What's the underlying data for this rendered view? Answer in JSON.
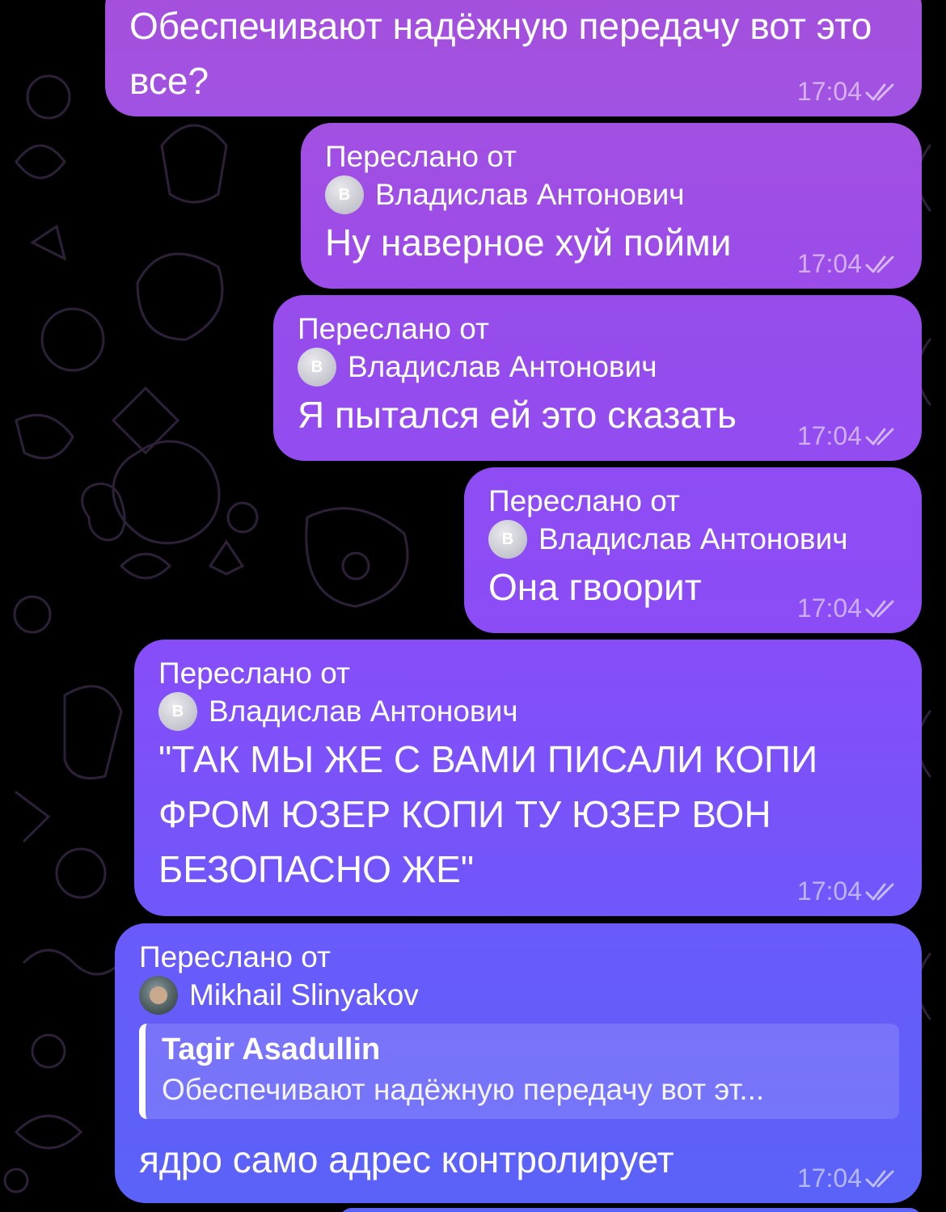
{
  "messages": [
    {
      "text": "Обеспечивают надёжную передачу вот это все?",
      "time": "17:04"
    },
    {
      "forward_label": "Переслано от",
      "forward_avatar_letter": "В",
      "forward_from": "Владислав Антонович",
      "text": "Ну наверное хуй пойми",
      "time": "17:04"
    },
    {
      "forward_label": "Переслано от",
      "forward_avatar_letter": "В",
      "forward_from": "Владислав Антонович",
      "text": "Я пытался ей это сказать",
      "time": "17:04"
    },
    {
      "forward_label": "Переслано от",
      "forward_avatar_letter": "В",
      "forward_from": "Владислав Антонович",
      "text": "Она гвоорит",
      "time": "17:04"
    },
    {
      "forward_label": "Переслано от",
      "forward_avatar_letter": "В",
      "forward_from": "Владислав Антонович",
      "text": "\"ТАК МЫ ЖЕ С ВАМИ ПИСАЛИ КОПИ ФРОМ ЮЗЕР КОПИ ТУ ЮЗЕР ВОН БЕЗОПАСНО ЖЕ\"",
      "time": "17:04"
    },
    {
      "forward_label": "Переслано от",
      "forward_from": "Mikhail Slinyakov",
      "reply_author": "Tagir Asadullin",
      "reply_text": "Обеспечивают надёжную передачу вот эт...",
      "text": "ядро само адрес контролирует",
      "time": "17:04"
    }
  ],
  "colors": {
    "bubble_top": "#a650dd",
    "bubble_mid": "#8d4cf7",
    "bubble_bottom": "#5a5ff6",
    "background": "#000000"
  }
}
